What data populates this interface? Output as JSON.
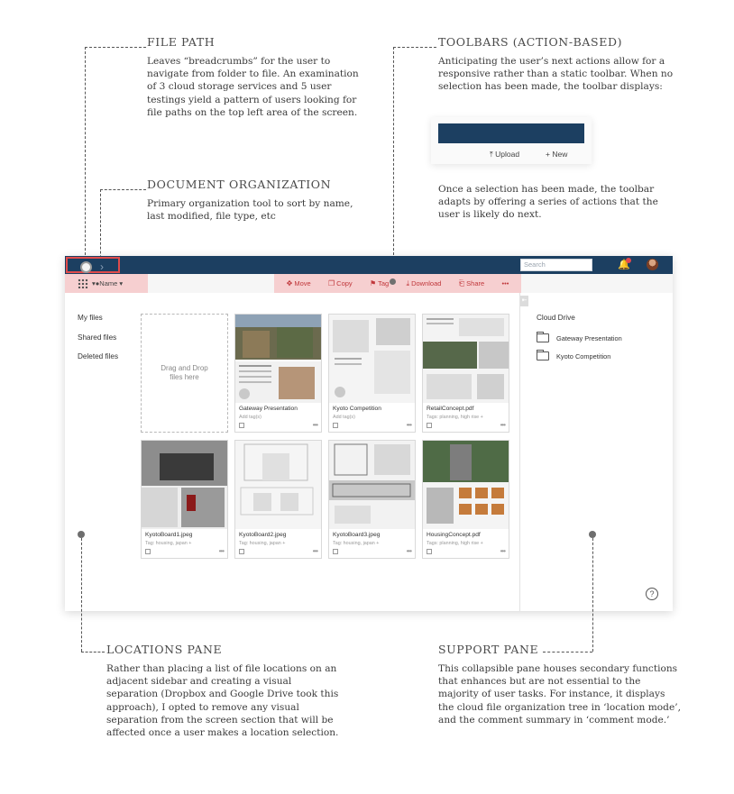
{
  "annotations": {
    "file_path": {
      "title": "FILE PATH",
      "body": "Leaves “breadcrumbs” for the user to navigate from folder to file. An examination of 3 cloud storage services and 5 user testings yield a pattern of users looking for file paths on the top left area of the screen."
    },
    "document_organization": {
      "title": "DOCUMENT ORGANIZATION",
      "body": "Primary organization tool to sort by name, last modified, file type, etc"
    },
    "toolbars": {
      "title": "TOOLBARS (ACTION-BASED)",
      "body": "Anticipating the user’s next actions allow for a responsive rather than a static toolbar. When no selection has been made, the toolbar displays:",
      "body2": "Once a selection has been made, the toolbar adapts by offering a series of actions that the user is likely do next.",
      "preview_upload": "Upload",
      "preview_new": "New"
    },
    "locations_pane": {
      "title": "LOCATIONS PANE",
      "body": "Rather than placing a list of file locations on an adjacent sidebar and creating a visual separation (Dropbox and Google Drive took this approach), I opted to remove any visual separation from the screen section that will be affected once a user makes a location selection."
    },
    "support_pane": {
      "title": "SUPPORT PANE",
      "body": "This collapsible pane houses secondary functions that enhances but are not essential to the majority of user tasks. For instance, it displays the cloud file organization tree in ‘location mode’, and the comment summary in ‘comment mode.’"
    }
  },
  "app": {
    "search_placeholder": "Search",
    "sort_label": "Name",
    "actions": [
      {
        "icon": "move-icon",
        "label": "Move"
      },
      {
        "icon": "copy-icon",
        "label": "Copy"
      },
      {
        "icon": "tag-icon",
        "label": "Tag"
      },
      {
        "icon": "download-icon",
        "label": "Download"
      },
      {
        "icon": "share-icon",
        "label": "Share"
      }
    ],
    "more_label": "•••",
    "locations": [
      "My files",
      "Shared files",
      "Deleted files"
    ],
    "dropzone": "Drag and Drop files here",
    "files": [
      {
        "name": "Gateway Presentation",
        "tag": "Add tag(s)"
      },
      {
        "name": "Kyoto Competition",
        "tag": "Add tag(s)"
      },
      {
        "name": "RetailConcept.pdf",
        "tag": "Tags: planning, high rise +"
      },
      {
        "name": "KyotoBoard1.jpeg",
        "tag": "Tag: housing, japan +"
      },
      {
        "name": "KyotoBoard2.jpeg",
        "tag": "Tag: housing, japan +"
      },
      {
        "name": "KyotoBoard3.jpeg",
        "tag": "Tag: housing, japan +"
      },
      {
        "name": "HousingConcept.pdf",
        "tag": "Tags: planning, high rise +"
      }
    ],
    "cloud_drive": "Cloud Drive",
    "folders": [
      "Gateway Presentation",
      "Kyoto Competition"
    ],
    "help": "?",
    "colors": {
      "navbar": "#1c3f61",
      "accent": "#f6cfd0",
      "action_text": "#c0373b",
      "highlight": "#e04b4b"
    }
  }
}
